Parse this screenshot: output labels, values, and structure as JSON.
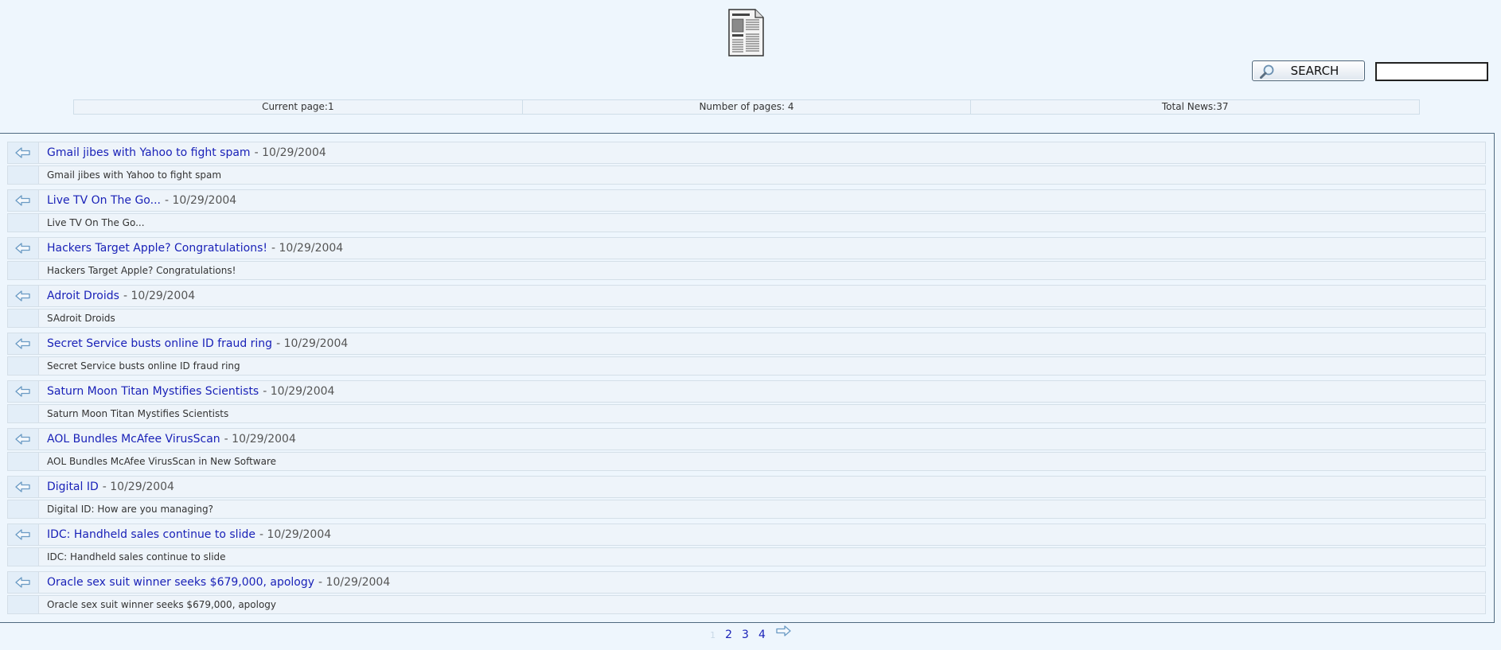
{
  "search": {
    "button_label": "SEARCH",
    "value": ""
  },
  "stats": {
    "current_page": "Current page:1",
    "number_of_pages": "Number of pages: 4",
    "total_news": "Total News:37"
  },
  "news": [
    {
      "title": "Gmail jibes with Yahoo to fight spam",
      "date": "- 10/29/2004",
      "desc": "Gmail jibes with Yahoo to fight spam"
    },
    {
      "title": "Live TV On The Go...",
      "date": "- 10/29/2004",
      "desc": "Live TV On The Go..."
    },
    {
      "title": "Hackers Target Apple? Congratulations!",
      "date": "- 10/29/2004",
      "desc": "Hackers Target Apple? Congratulations!"
    },
    {
      "title": "Adroit Droids",
      "date": "- 10/29/2004",
      "desc": "SAdroit Droids"
    },
    {
      "title": "Secret Service busts online ID fraud ring",
      "date": "- 10/29/2004",
      "desc": "Secret Service busts online ID fraud ring"
    },
    {
      "title": "Saturn Moon Titan Mystifies Scientists",
      "date": "- 10/29/2004",
      "desc": "Saturn Moon Titan Mystifies Scientists"
    },
    {
      "title": "AOL Bundles McAfee VirusScan",
      "date": "- 10/29/2004",
      "desc": "AOL Bundles McAfee VirusScan in New Software"
    },
    {
      "title": "Digital ID",
      "date": "- 10/29/2004",
      "desc": "Digital ID: How are you managing?"
    },
    {
      "title": "IDC: Handheld sales continue to slide",
      "date": "- 10/29/2004",
      "desc": "IDC: Handheld sales continue to slide"
    },
    {
      "title": "Oracle sex suit winner seeks $679,000, apology",
      "date": "- 10/29/2004",
      "desc": "Oracle sex suit winner seeks $679,000, apology"
    }
  ],
  "pager": {
    "current": "1",
    "pages": [
      "2",
      "3",
      "4"
    ]
  },
  "colors": {
    "background": "#eef6fd",
    "link": "#1a22b8",
    "arrow": "#6a9ac4"
  },
  "icons": {
    "logo": "newspaper-icon",
    "search": "magnifier-icon",
    "row": "left-arrow-icon",
    "next": "right-arrow-icon"
  }
}
